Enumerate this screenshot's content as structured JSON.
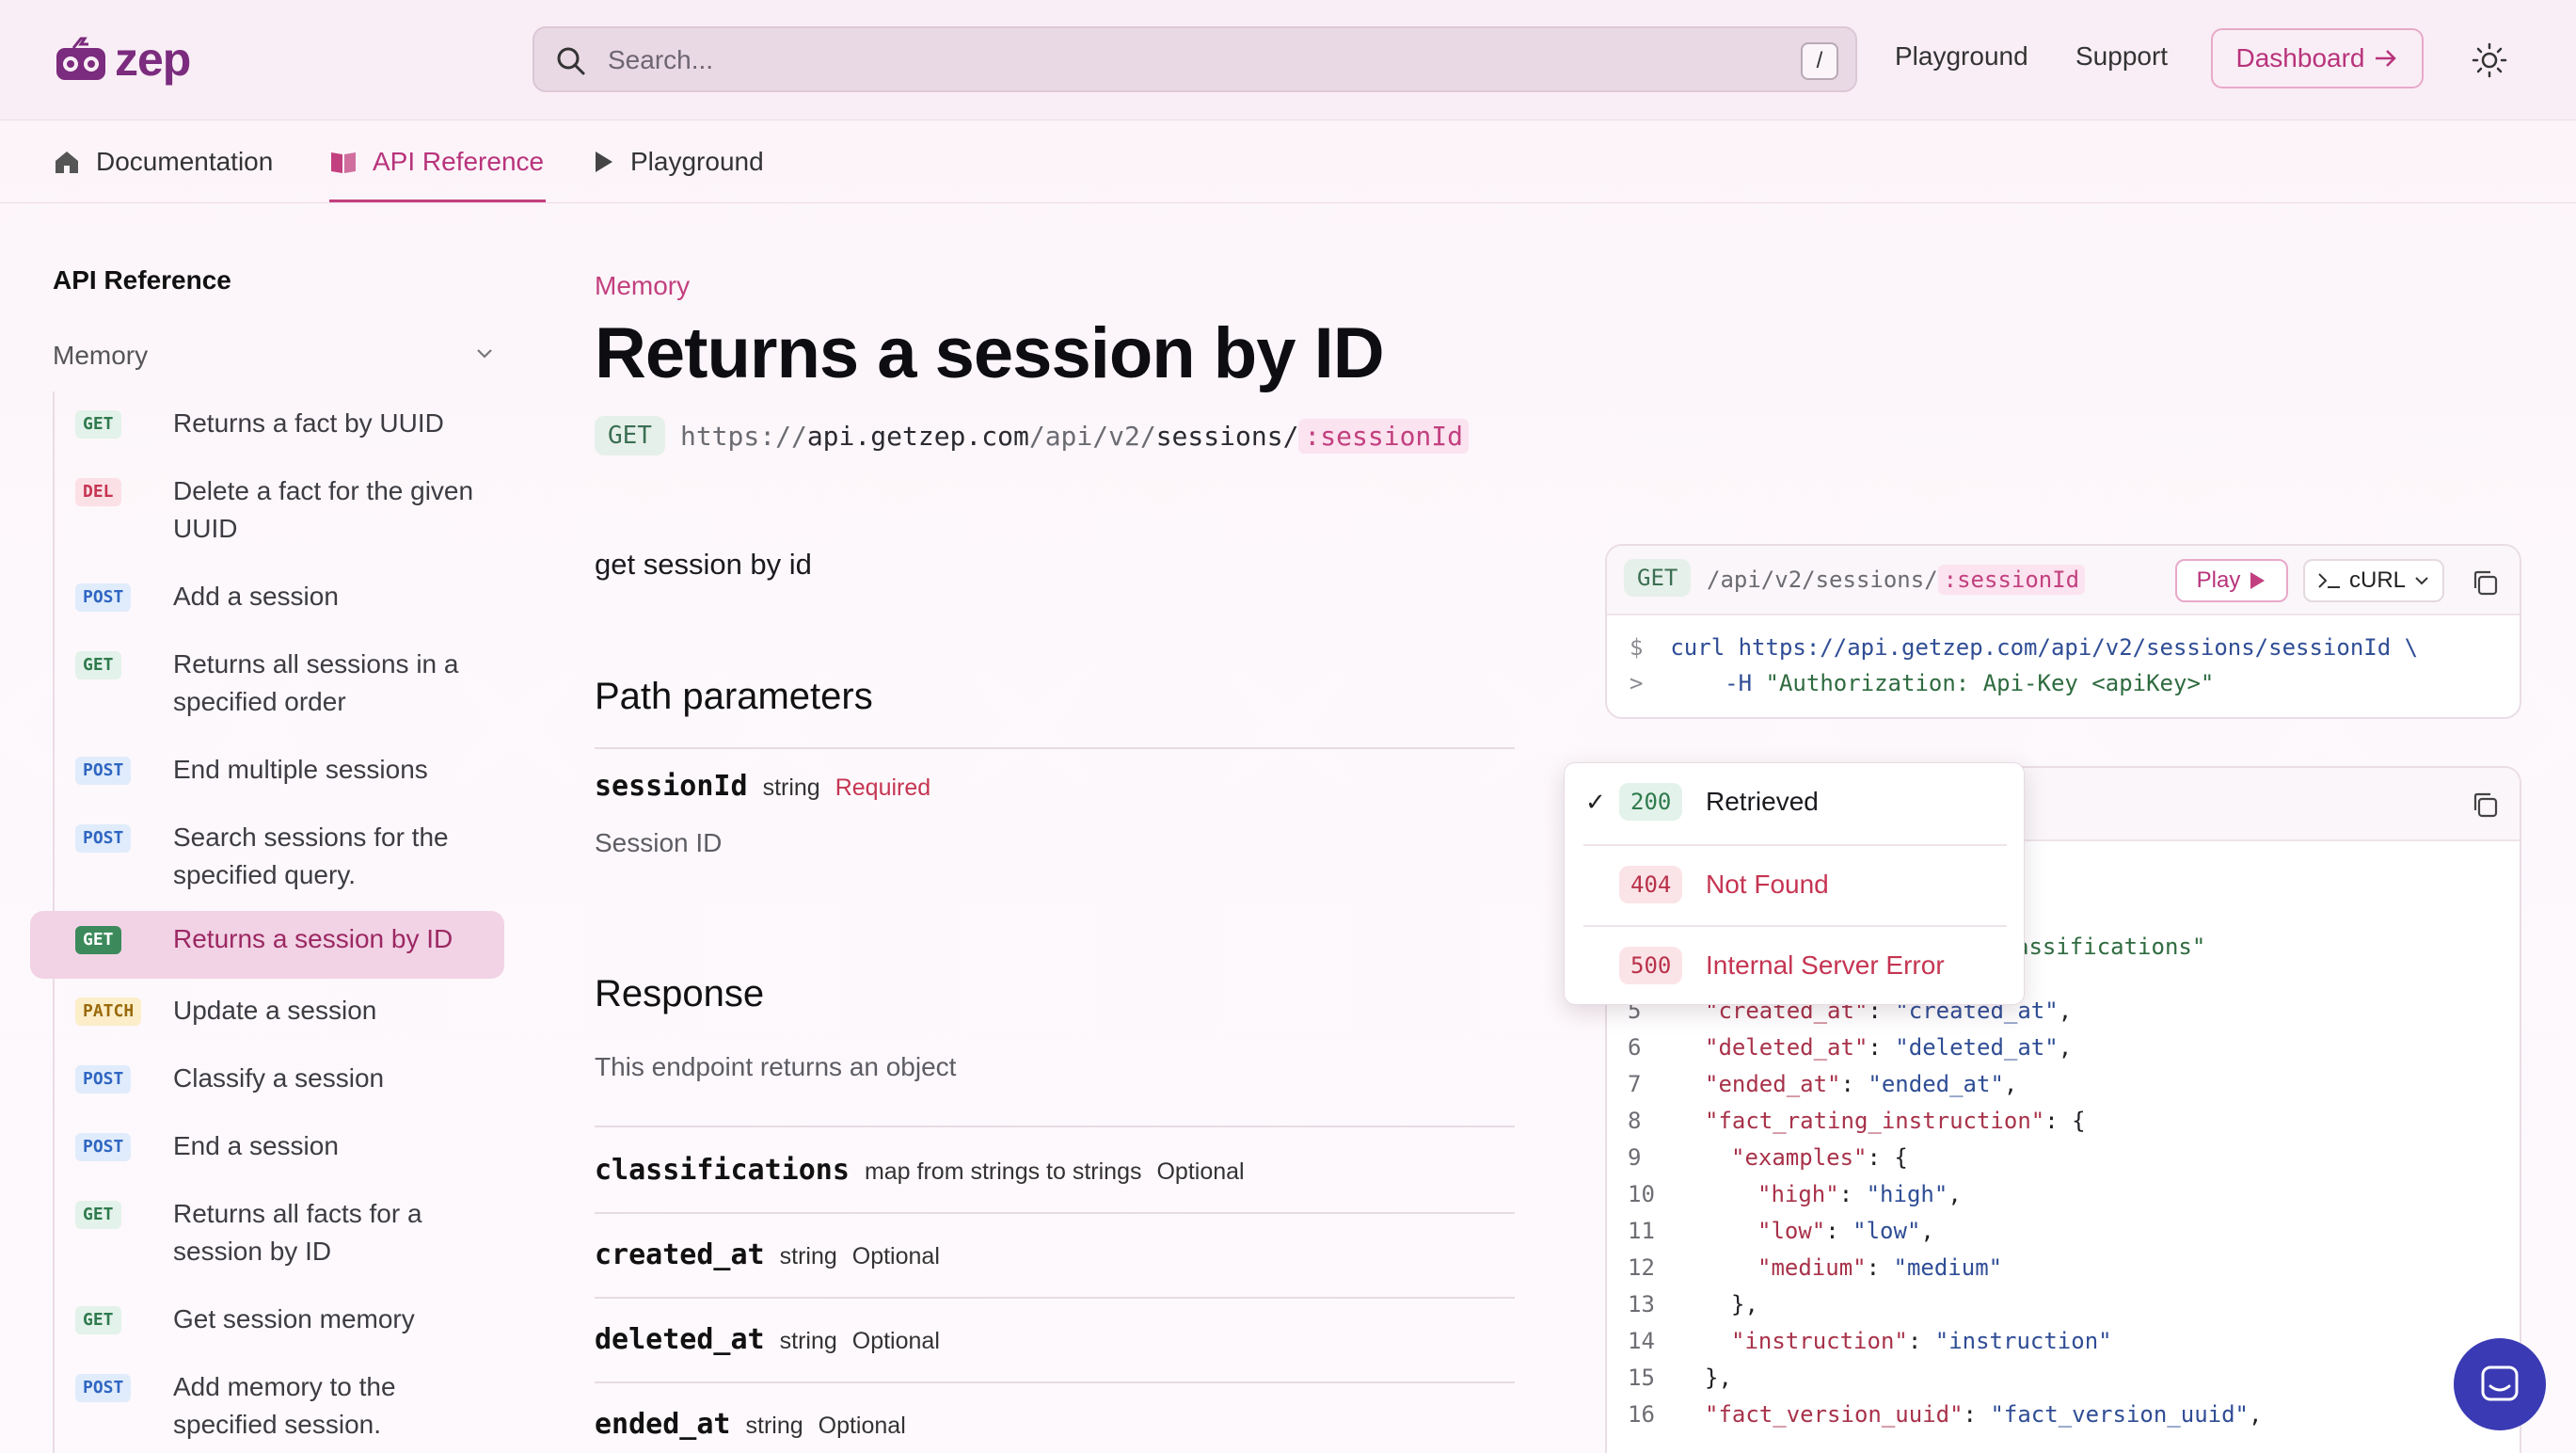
{
  "header": {
    "logo_text": "zep",
    "search_placeholder": "Search...",
    "search_shortcut": "/",
    "nav": [
      "Playground",
      "Support"
    ],
    "dashboard_label": "Dashboard"
  },
  "tabs": [
    {
      "label": "Documentation"
    },
    {
      "label": "API Reference"
    },
    {
      "label": "Playground"
    }
  ],
  "sidebar": {
    "title": "API Reference",
    "group": "Memory",
    "items": [
      {
        "method": "GET",
        "label": "Returns a fact by UUID"
      },
      {
        "method": "DEL",
        "label": "Delete a fact for the given UUID"
      },
      {
        "method": "POST",
        "label": "Add a session"
      },
      {
        "method": "GET",
        "label": "Returns all sessions in a specified order"
      },
      {
        "method": "POST",
        "label": "End multiple sessions"
      },
      {
        "method": "POST",
        "label": "Search sessions for the specified query."
      },
      {
        "method": "GET",
        "label": "Returns a session by ID"
      },
      {
        "method": "PATCH",
        "label": "Update a session"
      },
      {
        "method": "POST",
        "label": "Classify a session"
      },
      {
        "method": "POST",
        "label": "End a session"
      },
      {
        "method": "GET",
        "label": "Returns all facts for a session by ID"
      },
      {
        "method": "GET",
        "label": "Get session memory"
      },
      {
        "method": "POST",
        "label": "Add memory to the specified session."
      }
    ]
  },
  "main": {
    "breadcrumb": "Memory",
    "title": "Returns a session by ID",
    "method": "GET",
    "url_scheme": "https://",
    "url_host": "api.getzep.com",
    "url_seg1": "/api/v2/",
    "url_seg2": "sessions/",
    "url_param": ":sessionId",
    "description": "get session by id",
    "path_params_heading": "Path parameters",
    "param": {
      "name": "sessionId",
      "type": "string",
      "required": "Required",
      "desc": "Session ID"
    },
    "response_heading": "Response",
    "response_desc": "This endpoint returns an object",
    "fields": [
      {
        "name": "classifications",
        "type": "map from strings to strings",
        "opt": "Optional"
      },
      {
        "name": "created_at",
        "type": "string",
        "opt": "Optional"
      },
      {
        "name": "deleted_at",
        "type": "string",
        "opt": "Optional"
      },
      {
        "name": "ended_at",
        "type": "string",
        "opt": "Optional"
      }
    ]
  },
  "code_card": {
    "method": "GET",
    "path": "/api/v2/sessions/",
    "param": ":sessionId",
    "play_label": "Play",
    "lang_label": "cURL",
    "line1_prompt": "$",
    "line1_cmd": "curl",
    "line1_url": "https://api.getzep.com/api/v2/sessions/sessionId \\",
    "line2_prompt": ">",
    "line2_flag": "-H",
    "line2_value": "\"Authorization: Api-Key <apiKey>\""
  },
  "dropdown": {
    "items": [
      {
        "code": "200",
        "label": "Retrieved",
        "selected": true
      },
      {
        "code": "404",
        "label": "Not Found",
        "selected": false
      },
      {
        "code": "500",
        "label": "Internal Server Error",
        "selected": false
      }
    ]
  },
  "response_json": {
    "partial_line": "assifications\"",
    "lines": [
      {
        "n": "5",
        "key": "\"created_at\"",
        "sep": ": ",
        "val": "\"created_at\"",
        "end": ","
      },
      {
        "n": "6",
        "key": "\"deleted_at\"",
        "sep": ": ",
        "val": "\"deleted_at\"",
        "end": ","
      },
      {
        "n": "7",
        "key": "\"ended_at\"",
        "sep": ": ",
        "val": "\"ended_at\"",
        "end": ","
      },
      {
        "n": "8",
        "key": "\"fact_rating_instruction\"",
        "sep": ": ",
        "val": "",
        "end": "{"
      },
      {
        "n": "9",
        "key": "\"examples\"",
        "sep": ": ",
        "val": "",
        "end": "{"
      },
      {
        "n": "10",
        "key": "\"high\"",
        "sep": ": ",
        "val": "\"high\"",
        "end": ","
      },
      {
        "n": "11",
        "key": "\"low\"",
        "sep": ": ",
        "val": "\"low\"",
        "end": ","
      },
      {
        "n": "12",
        "key": "\"medium\"",
        "sep": ": ",
        "val": "\"medium\"",
        "end": ""
      },
      {
        "n": "13",
        "key": "",
        "sep": "",
        "val": "",
        "end": "},"
      },
      {
        "n": "14",
        "key": "\"instruction\"",
        "sep": ": ",
        "val": "\"instruction\"",
        "end": ""
      },
      {
        "n": "15",
        "key": "",
        "sep": "",
        "val": "",
        "end": "},"
      },
      {
        "n": "16",
        "key": "\"fact_version_uuid\"",
        "sep": ": ",
        "val": "\"fact_version_uuid\"",
        "end": ","
      }
    ]
  }
}
